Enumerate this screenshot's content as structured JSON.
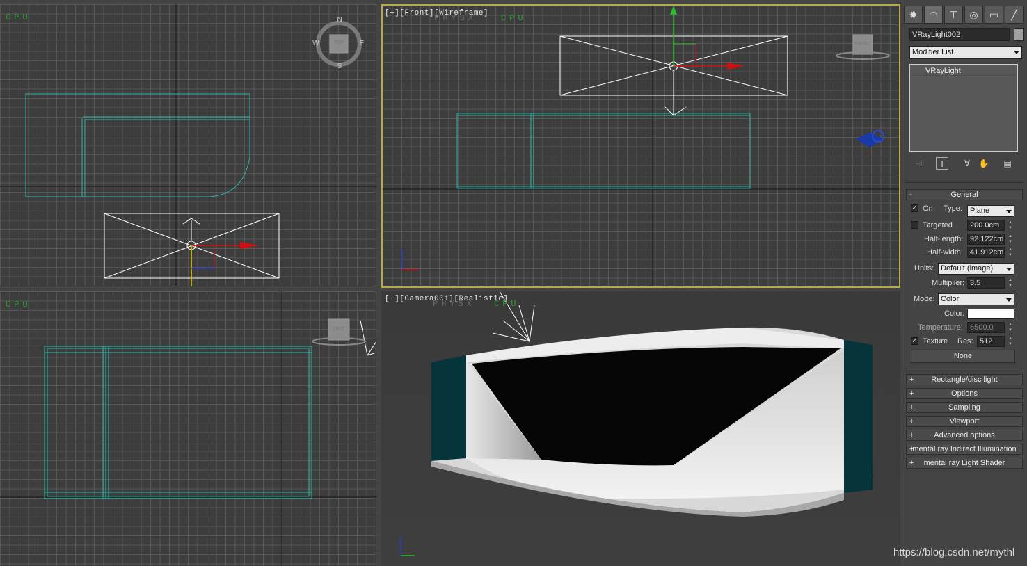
{
  "viewports": {
    "top": {
      "cpu_label": "CPU",
      "viewcube": {
        "face": "TOP",
        "n": "N",
        "s": "S",
        "e": "E",
        "w": "W"
      }
    },
    "front": {
      "label": "[+][Front][Wireframe]",
      "physx": "PHYSX",
      "cpu_label": "CPU",
      "viewcube": {
        "face": "FRONT"
      }
    },
    "left": {
      "cpu_label": "CPU",
      "viewcube": {
        "face": "LEFT"
      }
    },
    "camera": {
      "label": "[+][Camera001][Realistic]",
      "physx": "PHYSX",
      "cpu_label": "CPU"
    }
  },
  "command_panel": {
    "tabs": [
      {
        "icon": "create-icon",
        "glyph": "✹"
      },
      {
        "icon": "modify-icon",
        "glyph": "◠"
      },
      {
        "icon": "hierarchy-icon",
        "glyph": "⊤"
      },
      {
        "icon": "motion-icon",
        "glyph": "◎"
      },
      {
        "icon": "display-icon",
        "glyph": "▭"
      },
      {
        "icon": "utilities-icon",
        "glyph": "╱"
      }
    ],
    "object_name": "VRayLight002",
    "modifier_list": "Modifier List",
    "stack_items": [
      "VRayLight"
    ],
    "general": {
      "title": "General",
      "collapse_symbol": "-",
      "on_label": "On",
      "on_checked": true,
      "type_label": "Type:",
      "type_value": "Plane",
      "targeted_label": "Targeted",
      "targeted_checked": false,
      "targeted_value": "200.0cm",
      "half_length_label": "Half-length:",
      "half_length_value": "92.122cm",
      "half_width_label": "Half-width:",
      "half_width_value": "41.912cm",
      "units_label": "Units:",
      "units_value": "Default (image)",
      "multiplier_label": "Multiplier:",
      "multiplier_value": "3.5",
      "mode_label": "Mode:",
      "mode_value": "Color",
      "color_label": "Color:",
      "color_value": "#ffffff",
      "temperature_label": "Temperature:",
      "temperature_value": "6500.0",
      "texture_label": "Texture",
      "texture_checked": true,
      "res_label": "Res:",
      "res_value": "512",
      "none_button": "None"
    },
    "rollouts": [
      "Rectangle/disc light",
      "Options",
      "Sampling",
      "Viewport",
      "Advanced options",
      "mental ray Indirect Illumination",
      "mental ray Light Shader"
    ],
    "expand_symbol": "+"
  },
  "watermark": "https://blog.csdn.net/mythl",
  "colors": {
    "viewport_bg": "#3d3d3d",
    "grid": "#575757",
    "selection": "#2fb3a6",
    "active_border": "#b9a94a",
    "panel_bg": "#444444"
  }
}
